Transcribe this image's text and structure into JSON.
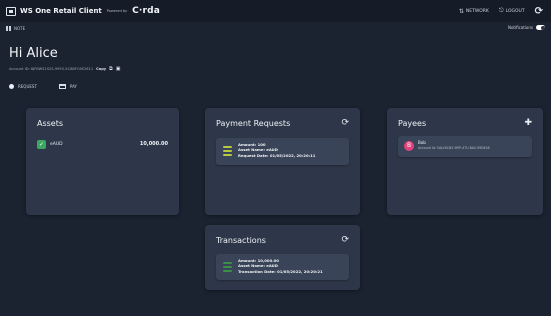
{
  "app": {
    "title": "WS One Retail Client",
    "powered_by": "Powered by",
    "brand": "C·rda"
  },
  "top_actions": {
    "network": "NETWORK",
    "logout": "LOGOUT"
  },
  "subbar": {
    "left_label": "NOTE",
    "notifications_label": "Notifications"
  },
  "greeting": "Hi Alice",
  "account": {
    "id_text": "Account ID: 6JFBWS1S2S-9955-5C8BFC6E2611",
    "copy_label": "Copy"
  },
  "tabs": [
    {
      "label": "REQUEST"
    },
    {
      "label": "PAY"
    }
  ],
  "assets": {
    "title": "Assets",
    "items": [
      {
        "name": "eAUD",
        "value": "10,000.00"
      }
    ]
  },
  "payment_requests": {
    "title": "Payment Requests",
    "items": [
      {
        "amount": "Amount: 100",
        "asset": "Asset Name: eAUD",
        "date": "Request Date: 01/05/2022, 20:20:11"
      }
    ]
  },
  "payees": {
    "title": "Payees",
    "items": [
      {
        "initial": "B",
        "name": "Bob",
        "detail": "Account Id: 5ALVXCN3-9FIP-4TU-8A0-99DE46"
      }
    ]
  },
  "transactions": {
    "title": "Transactions",
    "items": [
      {
        "amount": "Amount: 10,000.00",
        "asset": "Asset Name: eAUD",
        "date": "Transaction Date: 01/05/2022, 20:20:21"
      }
    ]
  },
  "colors": {
    "background": "#1b2230",
    "card": "#2e3749",
    "item": "#3a4458",
    "asset_badge": "#3aa860",
    "payee_avatar": "#e0427b"
  },
  "icons": {
    "refresh": "refresh-icon",
    "add_person": "add-person-icon"
  }
}
